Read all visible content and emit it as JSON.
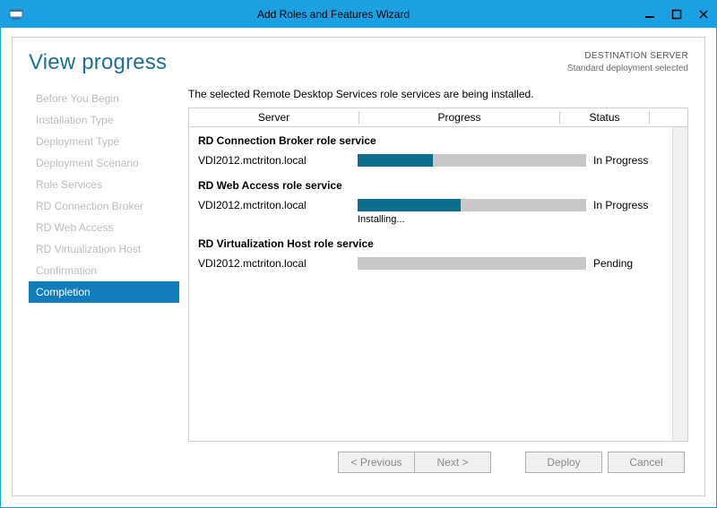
{
  "window": {
    "title": "Add Roles and Features Wizard"
  },
  "page_title": "View progress",
  "destination": {
    "label": "DESTINATION SERVER",
    "value": "Standard deployment selected"
  },
  "sidebar": {
    "items": [
      {
        "label": "Before You Begin"
      },
      {
        "label": "Installation Type"
      },
      {
        "label": "Deployment Type"
      },
      {
        "label": "Deployment Scenario"
      },
      {
        "label": "Role Services"
      },
      {
        "label": "RD Connection Broker"
      },
      {
        "label": "RD Web Access"
      },
      {
        "label": "RD Virtualization Host"
      },
      {
        "label": "Confirmation"
      },
      {
        "label": "Completion"
      }
    ],
    "active_index": 9
  },
  "description": "The selected Remote Desktop Services role services are being installed.",
  "columns": {
    "server": "Server",
    "progress": "Progress",
    "status": "Status"
  },
  "groups": [
    {
      "title": "RD Connection Broker role service",
      "rows": [
        {
          "server": "VDI2012.mctriton.local",
          "progress_pct": 33,
          "subtext": "",
          "status": "In Progress"
        }
      ]
    },
    {
      "title": "RD Web Access role service",
      "rows": [
        {
          "server": "VDI2012.mctriton.local",
          "progress_pct": 45,
          "subtext": "Installing...",
          "status": "In Progress"
        }
      ]
    },
    {
      "title": "RD Virtualization Host role service",
      "rows": [
        {
          "server": "VDI2012.mctriton.local",
          "progress_pct": 0,
          "subtext": "",
          "status": "Pending"
        }
      ]
    }
  ],
  "buttons": {
    "previous": "< Previous",
    "next": "Next >",
    "deploy": "Deploy",
    "cancel": "Cancel"
  }
}
